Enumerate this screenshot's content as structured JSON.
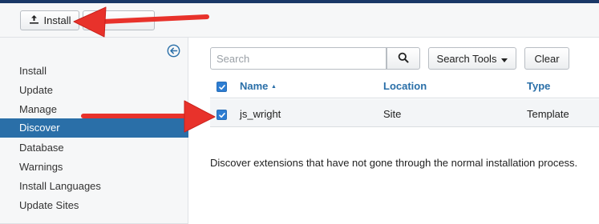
{
  "toolbar": {
    "install_label": "Install",
    "install_icon": "upload-icon"
  },
  "sidebar": {
    "collapse_icon": "circle-arrow-left-icon",
    "items": [
      {
        "label": "Install",
        "active": false
      },
      {
        "label": "Update",
        "active": false
      },
      {
        "label": "Manage",
        "active": false
      },
      {
        "label": "Discover",
        "active": true
      },
      {
        "label": "Database",
        "active": false
      },
      {
        "label": "Warnings",
        "active": false
      },
      {
        "label": "Install Languages",
        "active": false
      },
      {
        "label": "Update Sites",
        "active": false
      }
    ]
  },
  "filters": {
    "search_placeholder": "Search",
    "search_icon": "magnifier-icon",
    "search_tools_label": "Search Tools",
    "clear_label": "Clear"
  },
  "table": {
    "columns": {
      "name": "Name",
      "location": "Location",
      "type": "Type"
    },
    "sort_indicator": "▲",
    "select_all_checked": true,
    "rows": [
      {
        "name": "js_wright",
        "location": "Site",
        "type": "Template",
        "checked": true
      }
    ]
  },
  "message": "Discover extensions that have not gone through the normal installation process.",
  "colors": {
    "header_bar": "#1a3867",
    "active_nav": "#2a6fa8",
    "link": "#2a6fa8",
    "annotation_arrow": "#e8322b"
  }
}
